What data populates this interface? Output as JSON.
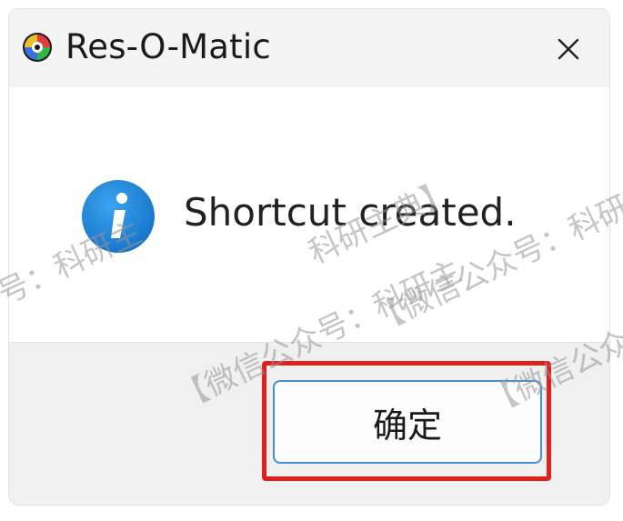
{
  "window": {
    "title": "Res-O-Matic",
    "close_icon": "close-icon",
    "app_icon": "res-o-matic-app-icon"
  },
  "dialog": {
    "icon": "info-icon",
    "message": "Shortcut created.",
    "ok_label": "确定"
  },
  "annotation": {
    "highlight_color": "#e0201e"
  },
  "watermarks": [
    "号：科研主",
    "【微信公众号：科研主",
    "科研主典】",
    "【微信公众号：科研主",
    "【微信公众号："
  ],
  "colors": {
    "titlebar_bg": "#f3f3f3",
    "footer_bg": "#f0f0f0",
    "button_border": "#4a8fd0",
    "info_blue": "#1f8ae0"
  }
}
